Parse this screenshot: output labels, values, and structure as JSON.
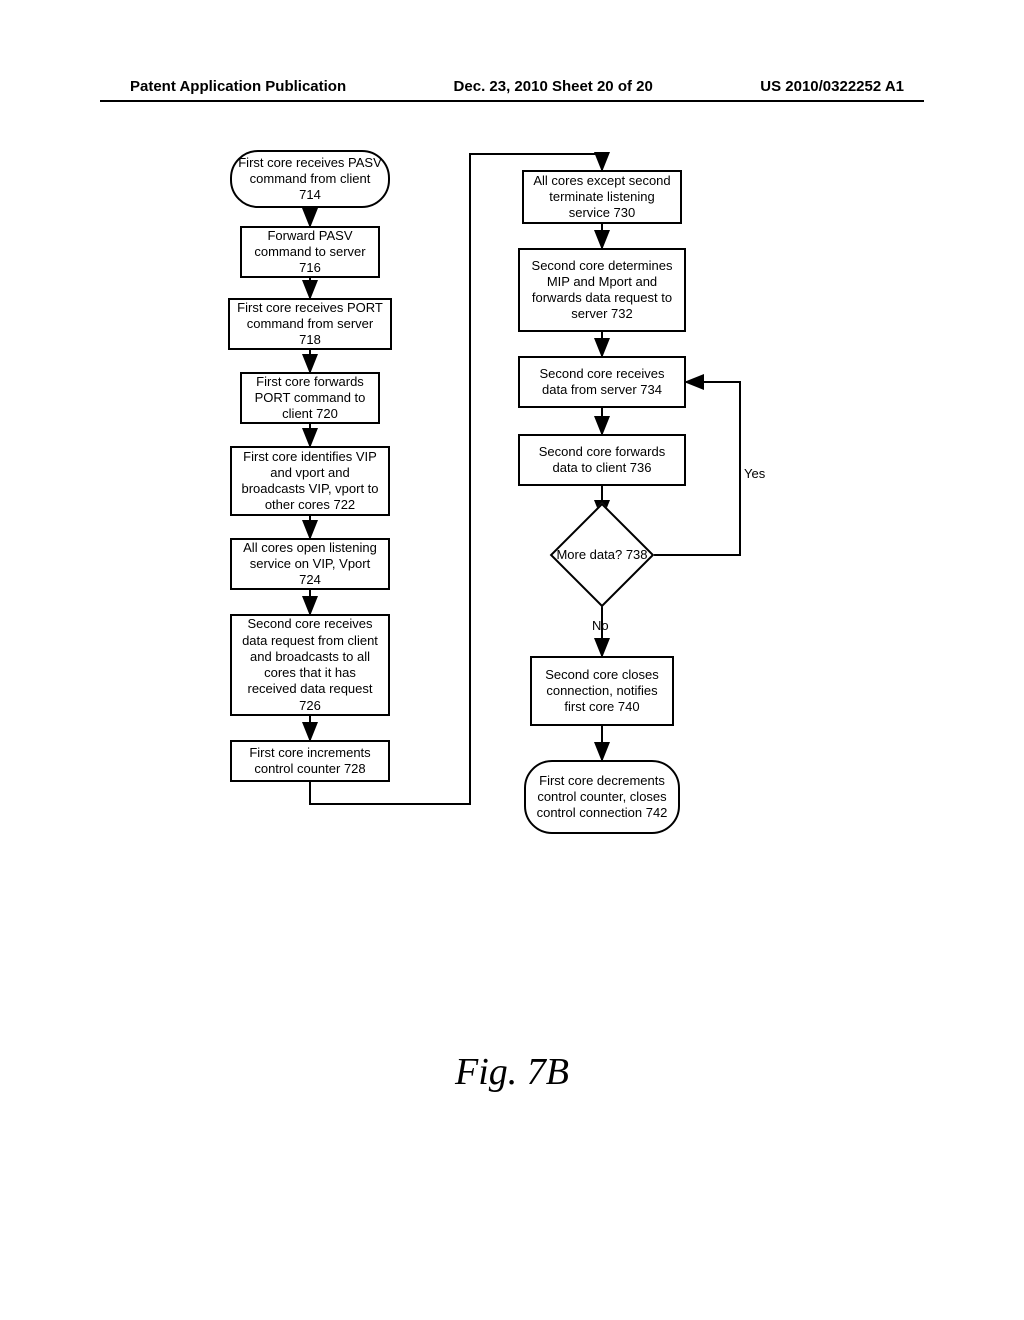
{
  "header": {
    "left": "Patent Application Publication",
    "center": "Dec. 23, 2010  Sheet 20 of 20",
    "right": "US 2010/0322252 A1"
  },
  "nodes": {
    "n714": "First core receives PASV command from client 714",
    "n716": "Forward PASV command to server 716",
    "n718": "First core receives PORT command from server 718",
    "n720": "First core forwards PORT command to client 720",
    "n722": "First core identifies VIP and vport and broadcasts VIP, vport to other cores 722",
    "n724": "All cores open listening service on VIP, Vport 724",
    "n726": "Second core receives data request from client and broadcasts to all cores that it has received data request 726",
    "n728": "First core increments control counter 728",
    "n730": "All cores except second terminate listening service 730",
    "n732": "Second core determines MIP and Mport and forwards data request to server 732",
    "n734": "Second core receives data from server 734",
    "n736": "Second core forwards data to client 736",
    "n738": "More data? 738",
    "n740": "Second core closes connection, notifies first core 740",
    "n742": "First core decrements control counter, closes control connection 742"
  },
  "labels": {
    "yes": "Yes",
    "no": "No"
  },
  "figure": "Fig. 7B",
  "chart_data": {
    "type": "flowchart",
    "title": "Fig. 7B",
    "nodes": [
      {
        "id": "714",
        "shape": "terminator",
        "text": "First core receives PASV command from client 714"
      },
      {
        "id": "716",
        "shape": "process",
        "text": "Forward PASV command to server 716"
      },
      {
        "id": "718",
        "shape": "process",
        "text": "First core receives PORT command from server 718"
      },
      {
        "id": "720",
        "shape": "process",
        "text": "First core forwards PORT command to client 720"
      },
      {
        "id": "722",
        "shape": "process",
        "text": "First core identifies VIP and vport and broadcasts VIP, vport to other cores 722"
      },
      {
        "id": "724",
        "shape": "process",
        "text": "All cores open listening service on VIP, Vport 724"
      },
      {
        "id": "726",
        "shape": "process",
        "text": "Second core receives data request from client and broadcasts to all cores that it has received data request 726"
      },
      {
        "id": "728",
        "shape": "process",
        "text": "First core increments control counter 728"
      },
      {
        "id": "730",
        "shape": "process",
        "text": "All cores except second terminate listening service 730"
      },
      {
        "id": "732",
        "shape": "process",
        "text": "Second core determines MIP and Mport and forwards data request to server 732"
      },
      {
        "id": "734",
        "shape": "process",
        "text": "Second core receives data from server 734"
      },
      {
        "id": "736",
        "shape": "process",
        "text": "Second core forwards data to client 736"
      },
      {
        "id": "738",
        "shape": "decision",
        "text": "More data? 738"
      },
      {
        "id": "740",
        "shape": "process",
        "text": "Second core closes connection, notifies first core 740"
      },
      {
        "id": "742",
        "shape": "terminator",
        "text": "First core decrements control counter, closes control connection 742"
      }
    ],
    "edges": [
      {
        "from": "714",
        "to": "716"
      },
      {
        "from": "716",
        "to": "718"
      },
      {
        "from": "718",
        "to": "720"
      },
      {
        "from": "720",
        "to": "722"
      },
      {
        "from": "722",
        "to": "724"
      },
      {
        "from": "724",
        "to": "726"
      },
      {
        "from": "726",
        "to": "728"
      },
      {
        "from": "728",
        "to": "730"
      },
      {
        "from": "730",
        "to": "732"
      },
      {
        "from": "732",
        "to": "734"
      },
      {
        "from": "734",
        "to": "736"
      },
      {
        "from": "736",
        "to": "738"
      },
      {
        "from": "738",
        "to": "734",
        "label": "Yes"
      },
      {
        "from": "738",
        "to": "740",
        "label": "No"
      },
      {
        "from": "740",
        "to": "742"
      }
    ]
  }
}
